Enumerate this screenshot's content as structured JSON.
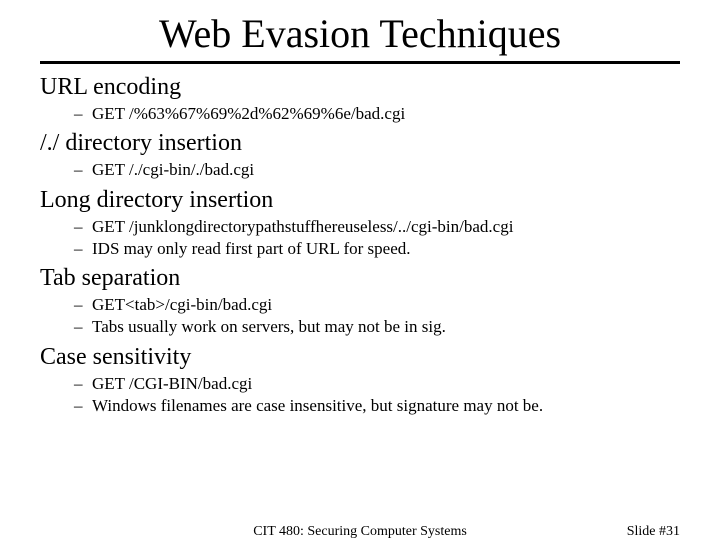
{
  "title": "Web Evasion Techniques",
  "sections": [
    {
      "label": "URL encoding",
      "subs": [
        "GET /%63%67%69%2d%62%69%6e/bad.cgi"
      ]
    },
    {
      "label": "/./ directory insertion",
      "subs": [
        "GET /./cgi-bin/./bad.cgi"
      ]
    },
    {
      "label": "Long directory insertion",
      "subs": [
        "GET /junklongdirectorypathstuffhereuseless/../cgi-bin/bad.cgi",
        "IDS may only read first part of URL for speed."
      ]
    },
    {
      "label": "Tab separation",
      "subs": [
        "GET<tab>/cgi-bin/bad.cgi",
        "Tabs usually work on servers, but may not be in sig."
      ]
    },
    {
      "label": "Case sensitivity",
      "subs": [
        "GET /CGI-BIN/bad.cgi",
        "Windows filenames are case insensitive, but signature may not be."
      ]
    }
  ],
  "footer": {
    "center": "CIT 480: Securing Computer Systems",
    "right": "Slide #31"
  }
}
